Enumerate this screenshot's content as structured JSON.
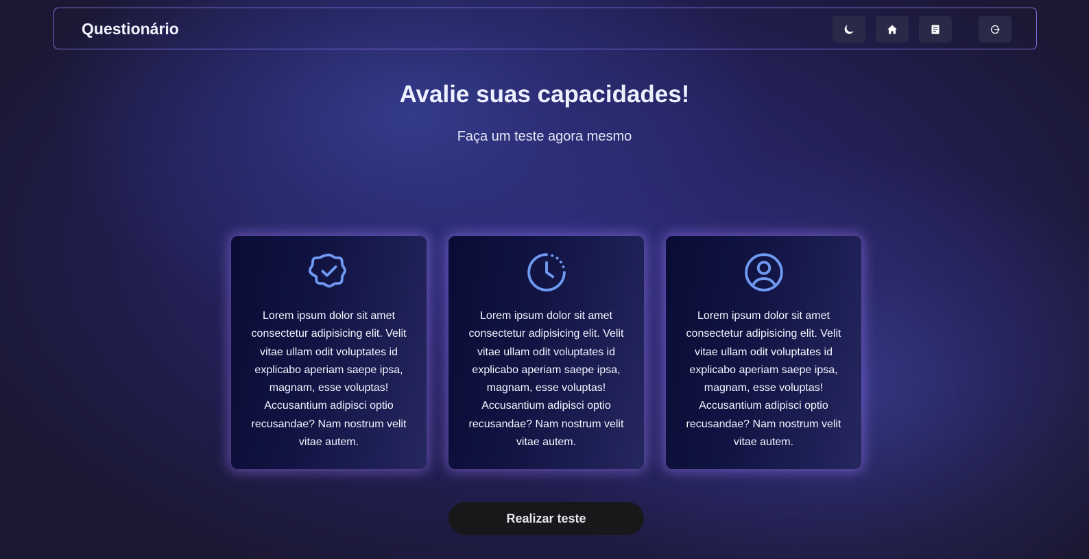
{
  "header": {
    "brand": "Questionário",
    "buttons": [
      {
        "icon": "moon-icon"
      },
      {
        "icon": "home-icon"
      },
      {
        "icon": "document-icon"
      },
      {
        "icon": "logout-icon"
      }
    ]
  },
  "hero": {
    "title": "Avalie suas capacidades!",
    "subtitle": "Faça um teste agora mesmo"
  },
  "cards": [
    {
      "icon": "verified-badge-icon",
      "text": "Lorem ipsum dolor sit amet consectetur adipisicing elit. Velit vitae ullam odit voluptates id explicabo aperiam saepe ipsa, magnam, esse voluptas! Accusantium adipisci optio recusandae? Nam nostrum velit vitae autem."
    },
    {
      "icon": "clock-icon",
      "text": "Lorem ipsum dolor sit amet consectetur adipisicing elit. Velit vitae ullam odit voluptates id explicabo aperiam saepe ipsa, magnam, esse voluptas! Accusantium adipisci optio recusandae? Nam nostrum velit vitae autem."
    },
    {
      "icon": "user-circle-icon",
      "text": "Lorem ipsum dolor sit amet consectetur adipisicing elit. Velit vitae ullam odit voluptates id explicabo aperiam saepe ipsa, magnam, esse voluptas! Accusantium adipisci optio recusandae? Nam nostrum velit vitae autem."
    }
  ],
  "cta": {
    "label": "Realizar teste"
  },
  "colors": {
    "accent_border": "#7e68d8",
    "icon_blue": "#6f9af2",
    "card_glow": "#9673eb",
    "button_bg": "#18181b"
  }
}
